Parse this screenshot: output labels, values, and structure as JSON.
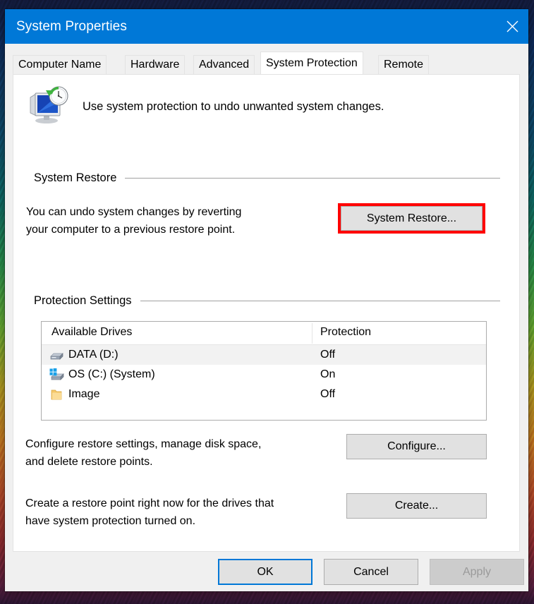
{
  "window": {
    "title": "System Properties",
    "close_icon": "close-icon"
  },
  "tabs": [
    {
      "label": "Computer Name",
      "active": false
    },
    {
      "label": "Hardware",
      "active": false
    },
    {
      "label": "Advanced",
      "active": false
    },
    {
      "label": "System Protection",
      "active": true
    },
    {
      "label": "Remote",
      "active": false
    }
  ],
  "header": {
    "icon": "system-restore-icon",
    "text": "Use system protection to undo unwanted system changes."
  },
  "system_restore": {
    "group_label": "System Restore",
    "description_line1": "You can undo system changes by reverting",
    "description_line2": "your computer to a previous restore point.",
    "button_label": "System Restore...",
    "highlight_color": "#ff0000"
  },
  "protection_settings": {
    "group_label": "Protection Settings",
    "columns": [
      "Available Drives",
      "Protection"
    ],
    "rows": [
      {
        "icon": "hard-drive-icon",
        "name": "DATA (D:)",
        "protection": "Off",
        "selected": true
      },
      {
        "icon": "system-drive-icon",
        "name": "OS (C:) (System)",
        "protection": "On",
        "selected": false
      },
      {
        "icon": "folder-icon",
        "name": "Image",
        "protection": "Off",
        "selected": false
      }
    ],
    "configure": {
      "description_line1": "Configure restore settings, manage disk space,",
      "description_line2": "and delete restore points.",
      "button_label": "Configure..."
    },
    "create": {
      "description_line1": "Create a restore point right now for the drives that",
      "description_line2": "have system protection turned on.",
      "button_label": "Create..."
    }
  },
  "footer": {
    "ok_label": "OK",
    "cancel_label": "Cancel",
    "apply_label": "Apply",
    "apply_disabled": true
  }
}
